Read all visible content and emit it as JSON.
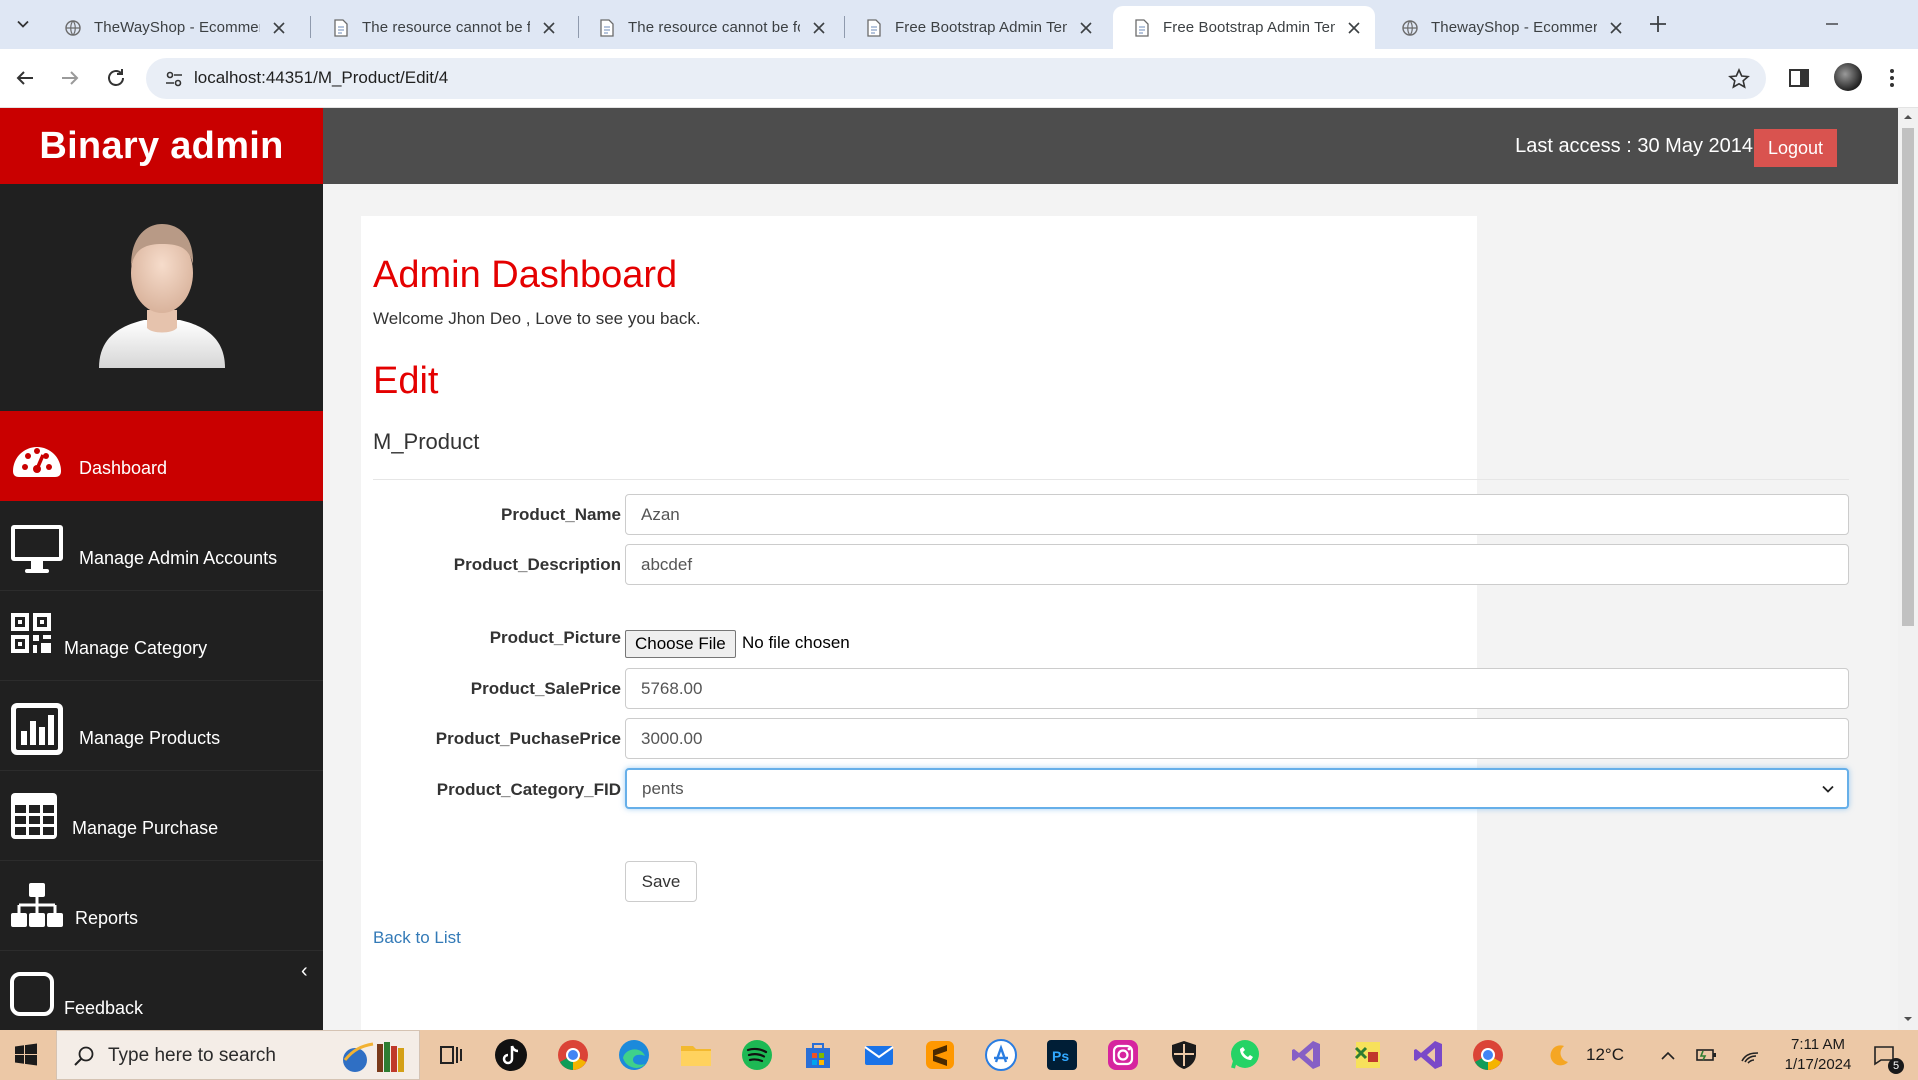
{
  "browser": {
    "tabs": [
      {
        "title": "TheWayShop - Ecommerce",
        "favicon": "globe-icon"
      },
      {
        "title": "The resource cannot be fou",
        "favicon": "page-icon"
      },
      {
        "title": "The resource cannot be fou",
        "favicon": "page-icon"
      },
      {
        "title": "Free Bootstrap Admin Tem",
        "favicon": "page-icon"
      },
      {
        "title": "Free Bootstrap Admin Tem",
        "favicon": "page-icon",
        "active": true
      },
      {
        "title": "ThewayShop - Ecommerce",
        "favicon": "globe-icon"
      }
    ],
    "url": "localhost:44351/M_Product/Edit/4"
  },
  "header": {
    "brand": "Binary admin",
    "last_access": "Last access : 30 May 2014",
    "logout": "Logout",
    "brand_color": "#c90000"
  },
  "sidebar": {
    "items": [
      {
        "label": "Dashboard",
        "icon": "dashboard-icon",
        "active": true
      },
      {
        "label": "Manage Admin Accounts",
        "icon": "desktop-icon"
      },
      {
        "label": "Manage Category",
        "icon": "qrcode-icon"
      },
      {
        "label": "Manage Products",
        "icon": "bar-chart-icon"
      },
      {
        "label": "Manage Purchase",
        "icon": "table-icon"
      },
      {
        "label": "Reports",
        "icon": "sitemap-icon"
      },
      {
        "label": "Feedback",
        "icon": "square-icon"
      }
    ]
  },
  "main": {
    "title": "Admin Dashboard",
    "welcome": "Welcome Jhon Deo , Love to see you back.",
    "edit_title": "Edit",
    "model_name": "M_Product",
    "fields": {
      "product_name": {
        "label": "Product_Name",
        "value": "Azan"
      },
      "product_description": {
        "label": "Product_Description",
        "value": "abcdef"
      },
      "product_picture": {
        "label": "Product_Picture",
        "button": "Choose File",
        "status": "No file chosen"
      },
      "product_saleprice": {
        "label": "Product_SalePrice",
        "value": "5768.00"
      },
      "product_puchaseprice": {
        "label": "Product_PuchasePrice",
        "value": "3000.00"
      },
      "product_category_fid": {
        "label": "Product_Category_FID",
        "selected": "pents"
      }
    },
    "save": "Save",
    "back_link": "Back to List",
    "accent_color": "#e40000"
  },
  "taskbar": {
    "search_placeholder": "Type here to search",
    "weather": "12°C",
    "time": "7:11 AM",
    "date": "1/17/2024",
    "notifications": "5"
  }
}
